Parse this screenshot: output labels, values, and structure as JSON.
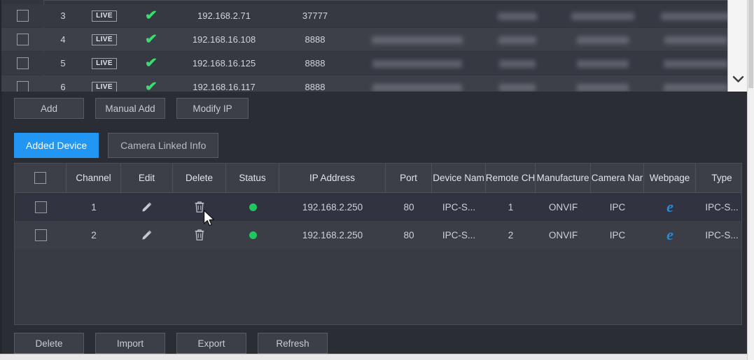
{
  "discovered_table": {
    "rows": [
      {
        "no": "3",
        "badge": "LIVE",
        "status_icon": "check-icon",
        "ip": "192.168.2.71",
        "port": "37777",
        "redacted": true
      },
      {
        "no": "4",
        "badge": "LIVE",
        "status_icon": "check-icon",
        "ip": "192.168.16.108",
        "port": "8888",
        "redacted": true
      },
      {
        "no": "5",
        "badge": "LIVE",
        "status_icon": "check-icon",
        "ip": "192.168.16.125",
        "port": "8888",
        "redacted": true
      },
      {
        "no": "6",
        "badge": "LIVE",
        "status_icon": "check-icon",
        "ip": "192.168.16.117",
        "port": "8888",
        "redacted": true
      }
    ],
    "scrollbar": {
      "down_arrow": "❯"
    }
  },
  "toolbar_top": {
    "buttons": [
      {
        "label": "Add"
      },
      {
        "label": "Manual Add"
      },
      {
        "label": "Modify IP"
      }
    ]
  },
  "tabs": [
    {
      "label": "Added Device",
      "active": true
    },
    {
      "label": "Camera Linked Info",
      "active": false
    }
  ],
  "added_device_table": {
    "headers": [
      "",
      "Channel",
      "Edit",
      "Delete",
      "Status",
      "IP Address",
      "Port",
      "Device Nam",
      "Remote CH",
      "Manufacture",
      "Camera Nar",
      "Webpage",
      "Type"
    ],
    "rows": [
      {
        "channel": "1",
        "edit_icon": "pencil-icon",
        "delete_icon": "trash-icon",
        "status": "online",
        "ip_address": "192.168.2.250",
        "port": "80",
        "device_name": "IPC-S...",
        "remote_ch": "1",
        "manufacturer": "ONVIF",
        "camera_name": "IPC",
        "webpage_icon": "internet-explorer-icon",
        "webpage_glyph": "e",
        "type": "IPC-S..."
      },
      {
        "channel": "2",
        "edit_icon": "pencil-icon",
        "delete_icon": "trash-icon",
        "status": "online",
        "ip_address": "192.168.2.250",
        "port": "80",
        "device_name": "IPC-S...",
        "remote_ch": "2",
        "manufacturer": "ONVIF",
        "camera_name": "IPC",
        "webpage_icon": "internet-explorer-icon",
        "webpage_glyph": "e",
        "type": "IPC-S..."
      }
    ]
  },
  "toolbar_bottom": {
    "buttons": [
      {
        "label": "Delete"
      },
      {
        "label": "Import"
      },
      {
        "label": "Export"
      },
      {
        "label": "Refresh"
      }
    ]
  },
  "colors": {
    "accent_blue": "#2196f3",
    "status_online": "#22c55e",
    "check_green": "#3ddc72",
    "panel_bg": "#383a44",
    "row_odd": "#313340",
    "row_even": "#3b3d47",
    "ie_blue": "#1e8fe0"
  }
}
